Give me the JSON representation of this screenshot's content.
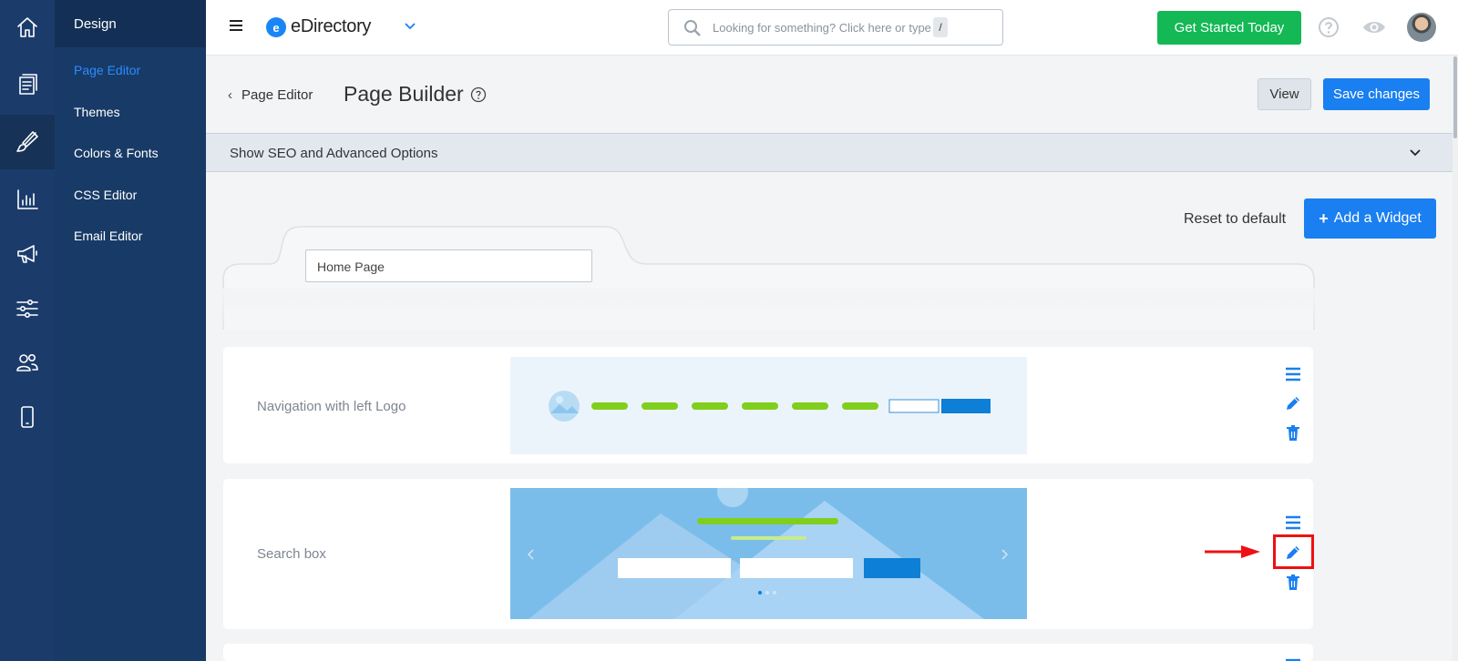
{
  "rail": {
    "items": [
      "home-icon",
      "pages-icon",
      "brush-icon",
      "chart-icon",
      "megaphone-icon",
      "sliders-icon",
      "users-icon",
      "mobile-icon"
    ],
    "active": "brush-icon"
  },
  "submenu": {
    "header": "Design",
    "items": [
      {
        "label": "Page Editor",
        "active": true
      },
      {
        "label": "Themes",
        "active": false
      },
      {
        "label": "Colors & Fonts",
        "active": false
      },
      {
        "label": "CSS Editor",
        "active": false
      },
      {
        "label": "Email Editor",
        "active": false
      }
    ]
  },
  "topbar": {
    "logo_letter": "e",
    "brand": "eDirectory",
    "search_placeholder": "Looking for something? Click here or type",
    "search_shortcut": "/",
    "cta": "Get Started Today"
  },
  "header": {
    "back_label": "Page Editor",
    "title": "Page Builder",
    "view_button": "View",
    "save_button": "Save changes"
  },
  "seo": {
    "label": "Show SEO and Advanced Options"
  },
  "toolbar": {
    "reset": "Reset to default",
    "add_widget": "Add a Widget"
  },
  "page": {
    "name": "Home Page"
  },
  "widgets": [
    {
      "label": "Navigation with left Logo"
    },
    {
      "label": "Search box"
    }
  ],
  "colors": {
    "rail": "#1b3c6b",
    "submenu": "#183a66",
    "accent": "#1a7ff0",
    "cta": "#14b855",
    "highlight": "#ee1111",
    "preview_green": "#7fcf1c",
    "preview_blue": "#7bbdea"
  }
}
